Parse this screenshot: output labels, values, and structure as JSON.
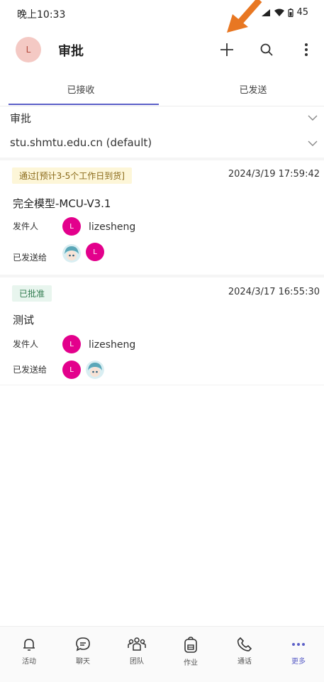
{
  "status_bar": {
    "time": "晚上10:33",
    "battery": "45"
  },
  "header": {
    "avatar_initial": "L",
    "title": "审批"
  },
  "tabs": [
    {
      "label": "已接收",
      "active": true
    },
    {
      "label": "已发送",
      "active": false
    }
  ],
  "filters": {
    "type": "审批",
    "domain": "stu.shmtu.edu.cn (default)"
  },
  "cards": [
    {
      "status": "通过[预计3-5个工作日到货]",
      "date": "2024/3/19 17:59:42",
      "title": "完全模型-MCU-V3.1",
      "sender_label": "发件人",
      "sender_initial": "L",
      "sender_name": "lizesheng",
      "sent_to_label": "已发送给",
      "sent_to_initial": "L"
    },
    {
      "status": "已批准",
      "date": "2024/3/17 16:55:30",
      "title": "测试",
      "sender_label": "发件人",
      "sender_initial": "L",
      "sender_name": "lizesheng",
      "sent_to_label": "已发送给",
      "sent_to_initial": "L"
    }
  ],
  "bottom_nav": [
    {
      "label": "活动",
      "icon": "bell-icon"
    },
    {
      "label": "聊天",
      "icon": "chat-icon"
    },
    {
      "label": "团队",
      "icon": "teams-icon"
    },
    {
      "label": "作业",
      "icon": "backpack-icon"
    },
    {
      "label": "通话",
      "icon": "phone-icon"
    },
    {
      "label": "更多",
      "icon": "more-icon",
      "active": true
    }
  ],
  "colors": {
    "accent": "#5b5fc7",
    "avatar_pink": "#e3008c",
    "arrow": "#e87722"
  }
}
